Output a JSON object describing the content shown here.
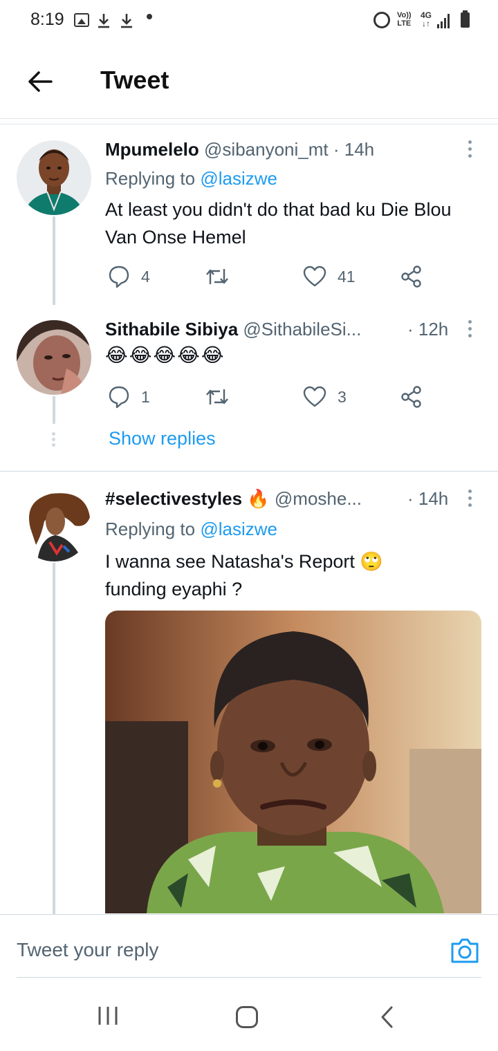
{
  "status_bar": {
    "time": "8:19",
    "icons": [
      "image-icon",
      "download-icon",
      "download-icon",
      "dot-icon",
      "alarm-icon",
      "volte-icon",
      "4g-icon",
      "signal-icon",
      "battery-icon"
    ],
    "volte_label_1": "Vo))",
    "volte_label_2": "LTE",
    "network_label": "4G",
    "network_arrows": "↓↑"
  },
  "header": {
    "title": "Tweet"
  },
  "tweets": [
    {
      "name": "Mpumelelo",
      "handle": "@sibanyoni_mt",
      "time": "· 14h",
      "replying_to_label": "Replying to",
      "replying_to_handle": "@lasizwe",
      "text": "At least you didn't do that bad ku Die Blou Van Onse Hemel",
      "replies": "4",
      "retweets": "",
      "likes": "41"
    },
    {
      "name": "Sithabile Sibiya",
      "handle": "@SithabileSi...",
      "time": "· 12h",
      "text": "😂😂😂😂😂",
      "replies": "1",
      "retweets": "",
      "likes": "3",
      "show_replies": "Show replies"
    },
    {
      "name": "#selectivestyles 🔥",
      "handle": "@moshe...",
      "time": "· 14h",
      "replying_to_label": "Replying to",
      "replying_to_handle": "@lasizwe",
      "text_line1": "I wanna see Natasha's Report 🙄",
      "text_line2": "funding eyaphi ?"
    }
  ],
  "reply_bar": {
    "placeholder": "Tweet your reply"
  },
  "colors": {
    "accent": "#1d9bf0",
    "secondary_text": "#536471",
    "border": "#cfd9de"
  }
}
